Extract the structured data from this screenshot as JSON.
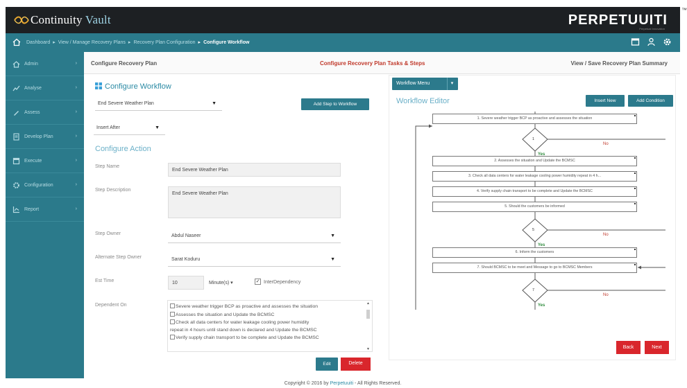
{
  "app": {
    "logo_main": "Continuity",
    "logo_sub": "Vault",
    "brand": "PERPETUUITI",
    "brand_tagline": "Perpetual Innovation",
    "tm": "™"
  },
  "breadcrumb": {
    "items": [
      "Dashboard",
      "View / Manage Recovery Plans",
      "Recovery Plan Configuration"
    ],
    "current": "Configure Workflow"
  },
  "sidebar": {
    "items": [
      {
        "label": "Admin",
        "icon": "person-icon"
      },
      {
        "label": "Analyse",
        "icon": "chart-icon"
      },
      {
        "label": "Assess",
        "icon": "pencil-icon"
      },
      {
        "label": "Develop Plan",
        "icon": "document-icon"
      },
      {
        "label": "Execute",
        "icon": "window-icon"
      },
      {
        "label": "Configuration",
        "icon": "gear-icon"
      },
      {
        "label": "Report",
        "icon": "report-icon"
      }
    ]
  },
  "steps": {
    "step1": "Configure Recovery Plan",
    "step2": "Configure Recovery Plan Tasks & Steps",
    "step3": "View / Save Recovery Plan Summary"
  },
  "left": {
    "title": "Configure Workflow",
    "plan_select": "End Severe Weather Plan",
    "add_step_label": "Add Step to Workflow",
    "insert_select": "Insert After",
    "action_title": "Configure Action",
    "step_name_label": "Step Name",
    "step_name_value": "End Severe Weather Plan",
    "step_desc_label": "Step Description",
    "step_desc_value": "End Severe Weather Plan",
    "owner_label": "Step Owner",
    "owner_value": "Abdul Naseer",
    "alt_owner_label": "Alternate Step Owner",
    "alt_owner_value": "Sarat Koduru",
    "est_label": "Est Time",
    "est_value": "10",
    "est_unit": "Minute(s)",
    "interdep_label": "InterDependency",
    "dependent_label": "Dependent On",
    "dependent_items": [
      "Severe weather trigger BCP as proactive and assesses the situation",
      "Assesses the situation and Update the BCMSC",
      "Check all data centers for water leakage cooling power humidity",
      "repeat in 4 hours until stand down is declared and Update the BCMSC",
      "Verify supply chain transport to be complete and Update the BCMSC"
    ],
    "edit_label": "Edit",
    "delete_label": "Delete"
  },
  "right": {
    "menu_label": "Workflow Menu",
    "editor_title": "Workflow Editor",
    "insert_new": "Insert New",
    "add_condition": "Add Condition",
    "nodes": [
      "1.  Severe weather trigger BCP as proactive and assesses the situation",
      "2.  Assesses the situation and Update the BCMSC",
      "3.  Check all data centers for water leakage cooling power humidity repeat in 4 h...",
      "4.  Verify supply chain transport to be complete and Update the BCMSC",
      "5.  Should the customers be informed",
      "6.  Inform the customers",
      "7.  Should BCMSC to be meet and Message to go to BCMSC Members"
    ],
    "decisions": [
      "1",
      "5",
      "7"
    ],
    "yes": "Yes",
    "no": "No",
    "back_label": "Back",
    "next_label": "Next"
  },
  "footer": {
    "prefix": "Copyright © 2016 by",
    "company": "Perpetuuiti",
    "suffix": "- All Rights Reserved."
  }
}
